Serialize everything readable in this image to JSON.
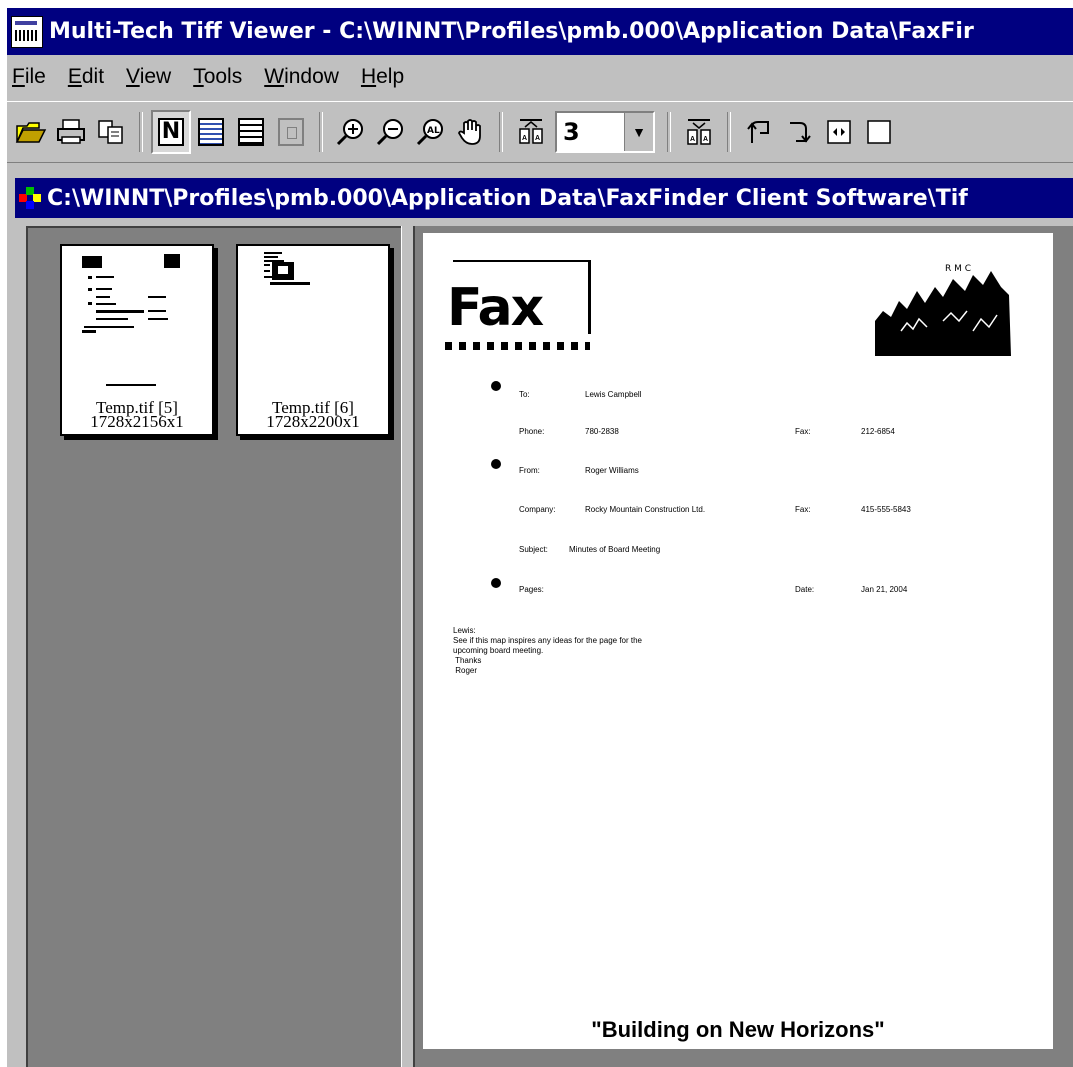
{
  "window": {
    "title": "Multi-Tech Tiff Viewer - C:\\WINNT\\Profiles\\pmb.000\\Application Data\\FaxFir"
  },
  "menu": [
    {
      "label": "File",
      "key": "F",
      "rest": "ile"
    },
    {
      "label": "Edit",
      "key": "E",
      "rest": "dit"
    },
    {
      "label": "View",
      "key": "V",
      "rest": "iew"
    },
    {
      "label": "Tools",
      "key": "T",
      "rest": "ools"
    },
    {
      "label": "Window",
      "key": "W",
      "rest": "indow"
    },
    {
      "label": "Help",
      "key": "H",
      "rest": "elp"
    }
  ],
  "toolbar": {
    "page_value": "3",
    "normal_label": "N"
  },
  "document": {
    "title": "C:\\WINNT\\Profiles\\pmb.000\\Application Data\\FaxFinder Client Software\\Tif"
  },
  "thumbnails": [
    {
      "name": "Temp.tif [5]",
      "size": "1728x2156x1"
    },
    {
      "name": "Temp.tif [6]",
      "size": "1728x2200x1"
    }
  ],
  "fax": {
    "logo_text": "Fax",
    "to_label": "To:",
    "to_value": "Lewis Campbell",
    "phone_label": "Phone:",
    "phone_value": "780-2838",
    "fax_label": "Fax:",
    "fax_value": "212-6854",
    "from_label": "From:",
    "from_value": "Roger Williams",
    "company_label": "Company:",
    "company_value": "Rocky Mountain Construction Ltd.",
    "company_fax_label": "Fax:",
    "company_fax_value": "415-555-5843",
    "subject_label": "Subject:",
    "subject_value": "Minutes of Board Meeting",
    "pages_label": "Pages:",
    "date_label": "Date:",
    "date_value": "Jan 21, 2004",
    "message": "Lewis:\nSee if this map inspires any ideas for the page for the\nupcoming board meeting.\n Thanks\n Roger",
    "slogan": "\"Building on New Horizons\""
  }
}
